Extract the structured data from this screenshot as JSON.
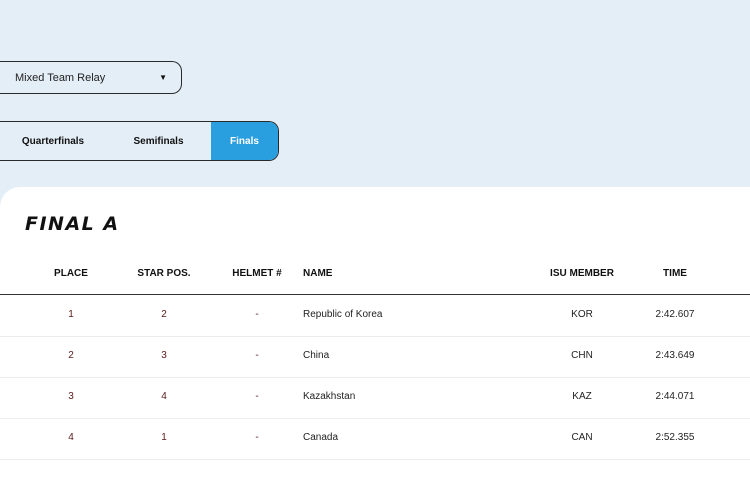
{
  "discipline": {
    "selected": "Mixed Team Relay"
  },
  "rounds": {
    "tabs": [
      "Quarterfinals",
      "Semifinals",
      "Finals"
    ],
    "active": "Finals"
  },
  "section_title": "FINAL A",
  "table": {
    "headers": [
      "PLACE",
      "STAR POS.",
      "HELMET #",
      "NAME",
      "ISU MEMBER",
      "TIME"
    ],
    "rows": [
      {
        "place": "1",
        "star_pos": "2",
        "helmet": "-",
        "name": "Republic of Korea",
        "isu_member": "KOR",
        "time": "2:42.607"
      },
      {
        "place": "2",
        "star_pos": "3",
        "helmet": "-",
        "name": "China",
        "isu_member": "CHN",
        "time": "2:43.649"
      },
      {
        "place": "3",
        "star_pos": "4",
        "helmet": "-",
        "name": "Kazakhstan",
        "isu_member": "KAZ",
        "time": "2:44.071"
      },
      {
        "place": "4",
        "star_pos": "1",
        "helmet": "-",
        "name": "Canada",
        "isu_member": "CAN",
        "time": "2:52.355"
      }
    ]
  },
  "colors": {
    "page_bg": "#e4eef7",
    "active_tab": "#2a9fe0",
    "panel_bg": "#ffffff"
  },
  "icons": {
    "dropdown": "caret-down-icon"
  }
}
